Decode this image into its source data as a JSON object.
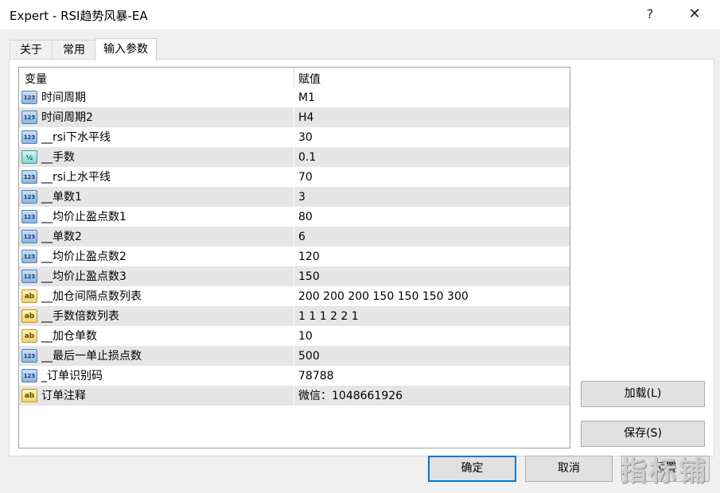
{
  "window": {
    "title": "Expert - RSI趋势风暴-EA",
    "help_label": "?",
    "close_label": "✕"
  },
  "tabs": [
    {
      "label": "关于",
      "active": false
    },
    {
      "label": "常用",
      "active": false
    },
    {
      "label": "输入参数",
      "active": true
    }
  ],
  "grid": {
    "columns": [
      "变量",
      "赋值"
    ],
    "rows": [
      {
        "type": "int",
        "icon": "123",
        "name": "时间周期",
        "value": "M1"
      },
      {
        "type": "int",
        "icon": "123",
        "name": "时间周期2",
        "value": "H4"
      },
      {
        "type": "int",
        "icon": "123",
        "name": "__rsi下水平线",
        "value": "30"
      },
      {
        "type": "double",
        "icon": "½",
        "name": "__手数",
        "value": "0.1"
      },
      {
        "type": "int",
        "icon": "123",
        "name": "__rsi上水平线",
        "value": "70"
      },
      {
        "type": "int",
        "icon": "123",
        "name": "__单数1",
        "value": "3"
      },
      {
        "type": "int",
        "icon": "123",
        "name": "__均价止盈点数1",
        "value": "80"
      },
      {
        "type": "int",
        "icon": "123",
        "name": "__单数2",
        "value": "6"
      },
      {
        "type": "int",
        "icon": "123",
        "name": "__均价止盈点数2",
        "value": "120"
      },
      {
        "type": "int",
        "icon": "123",
        "name": "__均价止盈点数3",
        "value": "150"
      },
      {
        "type": "string",
        "icon": "ab",
        "name": "__加仓间隔点数列表",
        "value": "200 200 200 150 150 150 300"
      },
      {
        "type": "string",
        "icon": "ab",
        "name": "__手数倍数列表",
        "value": "1 1 1 2 2 1"
      },
      {
        "type": "string",
        "icon": "ab",
        "name": "__加仓单数",
        "value": "10"
      },
      {
        "type": "int",
        "icon": "123",
        "name": "__最后一单止损点数",
        "value": "500"
      },
      {
        "type": "int",
        "icon": "123",
        "name": "_订单识别码",
        "value": "78788"
      },
      {
        "type": "string",
        "icon": "ab",
        "name": "订单注释",
        "value": "微信：1048661926"
      }
    ]
  },
  "buttons": {
    "load": "加载(L)",
    "save": "保存(S)",
    "ok": "确定",
    "cancel": "取消",
    "reset": "重置"
  },
  "watermark": "指标铺",
  "colors": {
    "row_alt": "#e6e6e6",
    "focus_border": "#0078d7"
  }
}
